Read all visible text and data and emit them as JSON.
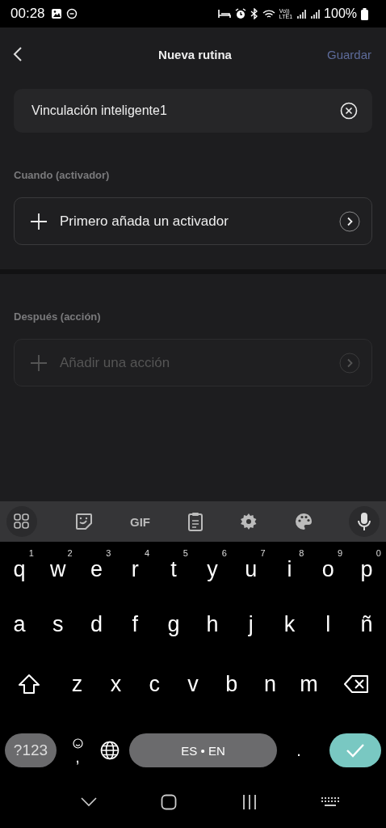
{
  "status_bar": {
    "time": "00:28",
    "network_top": "Vo))",
    "network_bottom": "LTE1",
    "battery": "100%"
  },
  "header": {
    "title": "Nueva rutina",
    "save": "Guardar"
  },
  "name_field": {
    "value": "Vinculación inteligente1"
  },
  "sections": [
    {
      "label": "Cuando (activador)",
      "action": {
        "text": "Primero añada un activador",
        "disabled": false
      }
    },
    {
      "label": "Después (acción)",
      "action": {
        "text": "Añadir una acción",
        "disabled": true
      }
    }
  ],
  "keyboard": {
    "toolbar": [
      {
        "kind": "apps"
      },
      {
        "kind": "sticker"
      },
      {
        "kind": "gif",
        "label": "GIF"
      },
      {
        "kind": "clipboard"
      },
      {
        "kind": "settings"
      },
      {
        "kind": "palette"
      },
      {
        "kind": "mic"
      }
    ],
    "row_1": [
      {
        "key": "q",
        "hint": "1"
      },
      {
        "key": "w",
        "hint": "2"
      },
      {
        "key": "e",
        "hint": "3"
      },
      {
        "key": "r",
        "hint": "4"
      },
      {
        "key": "t",
        "hint": "5"
      },
      {
        "key": "y",
        "hint": "6"
      },
      {
        "key": "u",
        "hint": "7"
      },
      {
        "key": "i",
        "hint": "8"
      },
      {
        "key": "o",
        "hint": "9"
      },
      {
        "key": "p",
        "hint": "0"
      }
    ],
    "row_2": [
      "a",
      "s",
      "d",
      "f",
      "g",
      "h",
      "j",
      "k",
      "l",
      "ñ"
    ],
    "row_3": [
      "z",
      "x",
      "c",
      "v",
      "b",
      "n",
      "m"
    ],
    "symbols_key": "?123",
    "comma_key": ",",
    "space_key": "ES • EN",
    "period_key": "."
  }
}
